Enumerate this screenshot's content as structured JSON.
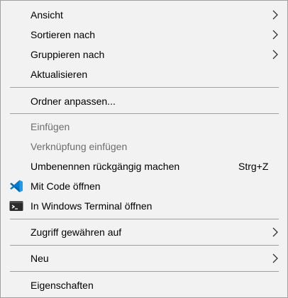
{
  "context_menu": {
    "items": {
      "view": {
        "label": "Ansicht",
        "has_submenu": true
      },
      "sort_by": {
        "label": "Sortieren nach",
        "has_submenu": true
      },
      "group_by": {
        "label": "Gruppieren nach",
        "has_submenu": true
      },
      "refresh": {
        "label": "Aktualisieren"
      },
      "customize_folder": {
        "label": "Ordner anpassen..."
      },
      "paste": {
        "label": "Einfügen",
        "enabled": false
      },
      "paste_shortcut": {
        "label": "Verknüpfung einfügen",
        "enabled": false
      },
      "undo_rename": {
        "label": "Umbenennen rückgängig machen",
        "shortcut": "Strg+Z"
      },
      "open_with_code": {
        "label": "Mit Code öffnen",
        "icon": "vscode-icon",
        "icon_color": "#0078d4"
      },
      "open_in_terminal": {
        "label": "In Windows Terminal öffnen",
        "icon": "terminal-icon",
        "icon_color": "#2b2b2b"
      },
      "give_access_to": {
        "label": "Zugriff gewähren auf",
        "has_submenu": true
      },
      "new": {
        "label": "Neu",
        "has_submenu": true
      },
      "properties": {
        "label": "Eigenschaften"
      }
    }
  },
  "colors": {
    "menu_background": "#f2f2f2",
    "border": "#a0a0a0",
    "separator": "#a0a0a0",
    "text": "#000000",
    "disabled_text": "#6d6d6d"
  }
}
